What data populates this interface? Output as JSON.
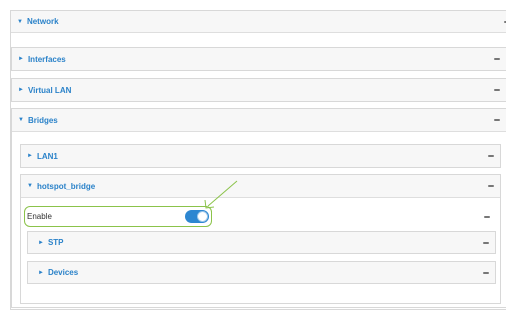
{
  "network": {
    "label": "Network",
    "caret": "▼"
  },
  "interfaces": {
    "label": "Interfaces",
    "caret": "►"
  },
  "virtual_lan": {
    "label": "Virtual LAN",
    "caret": "►"
  },
  "bridges": {
    "label": "Bridges",
    "caret": "▼"
  },
  "lan1": {
    "label": "LAN1",
    "caret": "►"
  },
  "hotspot_bridge": {
    "label": "hotspot_bridge",
    "caret": "▼",
    "enable": {
      "label": "Enable",
      "state": "on"
    },
    "stp": {
      "label": "STP",
      "caret": "►"
    },
    "devices": {
      "label": "Devices",
      "caret": "►"
    }
  },
  "colors": {
    "accent": "#2a82c9",
    "toggle_on": "#2d87d1",
    "highlight": "#8bc34a",
    "border": "#d8d8d8",
    "header_bg": "#f7f7f7"
  }
}
